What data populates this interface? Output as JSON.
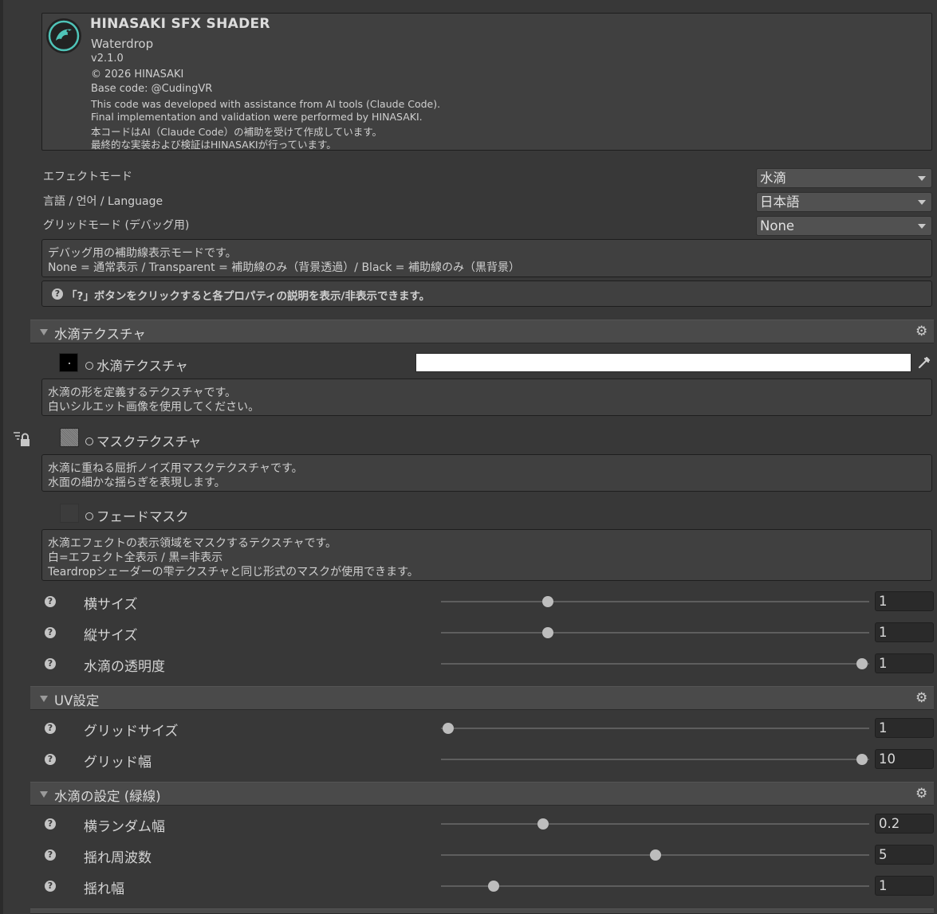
{
  "header": {
    "title": "HINASAKI SFX SHADER",
    "subtitle": "Waterdrop",
    "version": "v2.1.0",
    "copyright": "© 2026 HINASAKI",
    "base_code": "Base code: @CudingVR",
    "line_en_1": "This code was developed with assistance from AI tools (Claude Code).",
    "line_en_2": "Final implementation and validation were performed by HINASAKI.",
    "line_jp_1": "本コードはAI（Claude Code）の補助を受けて作成しています。",
    "line_jp_2": "最終的な実装および検証はHINASAKIが行っています。"
  },
  "settings": {
    "effect_mode": {
      "label": "エフェクトモード",
      "value": "水滴"
    },
    "language": {
      "label": "言語 / 언어 / Language",
      "value": "日本語"
    },
    "grid_mode": {
      "label": "グリッドモード (デバッグ用)",
      "value": "None"
    }
  },
  "grid_help": {
    "line1": "デバッグ用の補助線表示モードです。",
    "line2": "None = 通常表示 / Transparent = 補助線のみ（背景透過）/ Black = 補助線のみ（黒背景）"
  },
  "tip": "「?」ボタンをクリックすると各プロパティの説明を表示/非表示できます。",
  "sections": {
    "texture": {
      "title": "水滴テクスチャ"
    },
    "uv": {
      "title": "UV設定"
    },
    "drop": {
      "title": "水滴の設定 (緑線)"
    }
  },
  "textures": {
    "drop_tex": {
      "label": "水滴テクスチャ",
      "help1": "水滴の形を定義するテクスチャです。",
      "help2": "白いシルエット画像を使用してください。"
    },
    "mask_tex": {
      "label": "マスクテクスチャ",
      "help1": "水滴に重ねる屈折ノイズ用マスクテクスチャです。",
      "help2": "水面の細かな揺らぎを表現します。"
    },
    "fade_mask": {
      "label": "フェードマスク",
      "help1": "水滴エフェクトの表示領域をマスクするテクスチャです。",
      "help2": "白=エフェクト全表示 / 黒=非表示",
      "help3": "Teardropシェーダーの雫テクスチャと同じ形式のマスクが使用できます。"
    }
  },
  "properties": {
    "width": {
      "label": "横サイズ",
      "value": "1",
      "slider": 0.24
    },
    "height": {
      "label": "縦サイズ",
      "value": "1",
      "slider": 0.24
    },
    "opacity": {
      "label": "水滴の透明度",
      "value": "1",
      "slider": 1.0
    },
    "grid_size": {
      "label": "グリッドサイズ",
      "value": "1",
      "slider": 0.0
    },
    "grid_width": {
      "label": "グリッド幅",
      "value": "10",
      "slider": 1.0
    },
    "rand_width": {
      "label": "横ランダム幅",
      "value": "0.2",
      "slider": 0.23
    },
    "wobble_freq": {
      "label": "揺れ周波数",
      "value": "5",
      "slider": 0.5
    },
    "wobble_width": {
      "label": "揺れ幅",
      "value": "1",
      "slider": 0.11
    }
  },
  "icons": {
    "help": "help-icon",
    "gear": "gear-icon",
    "lock": "lock-icon",
    "eyedropper": "eyedropper-icon"
  }
}
